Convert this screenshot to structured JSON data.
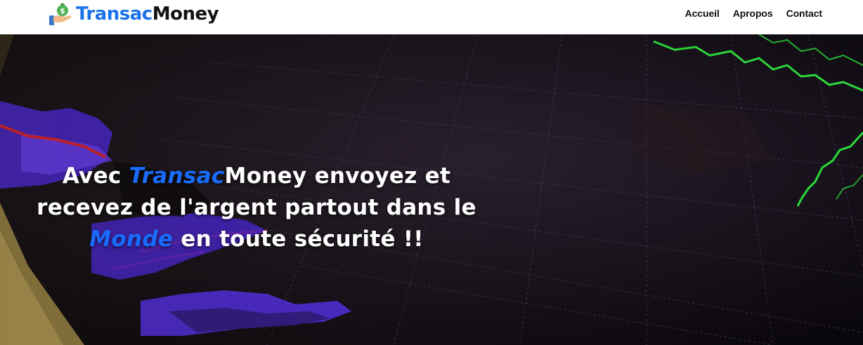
{
  "brand": {
    "name_part1": "Transac",
    "name_part2": "Money",
    "logo_icon": "money-bag-hand-icon"
  },
  "nav": {
    "items": [
      {
        "label": "Accueil"
      },
      {
        "label": "Apropos"
      },
      {
        "label": "Contact"
      }
    ]
  },
  "hero": {
    "line1_prefix": "Avec ",
    "line1_accent": "Transac",
    "line1_suffix": "Money envoyez et",
    "line2": "recevez de l'argent partout dans le",
    "line3_accent": "Monde",
    "line3_suffix": " en toute sécurité !!",
    "background": "trading-chart-screen"
  },
  "colors": {
    "brand_blue": "#1a73e8",
    "accent_blue": "#1a6cff",
    "chart_green": "#2bdc3a",
    "chart_purple": "#5a2cff",
    "chart_red": "#e8202a",
    "hero_dark": "#120d14"
  }
}
